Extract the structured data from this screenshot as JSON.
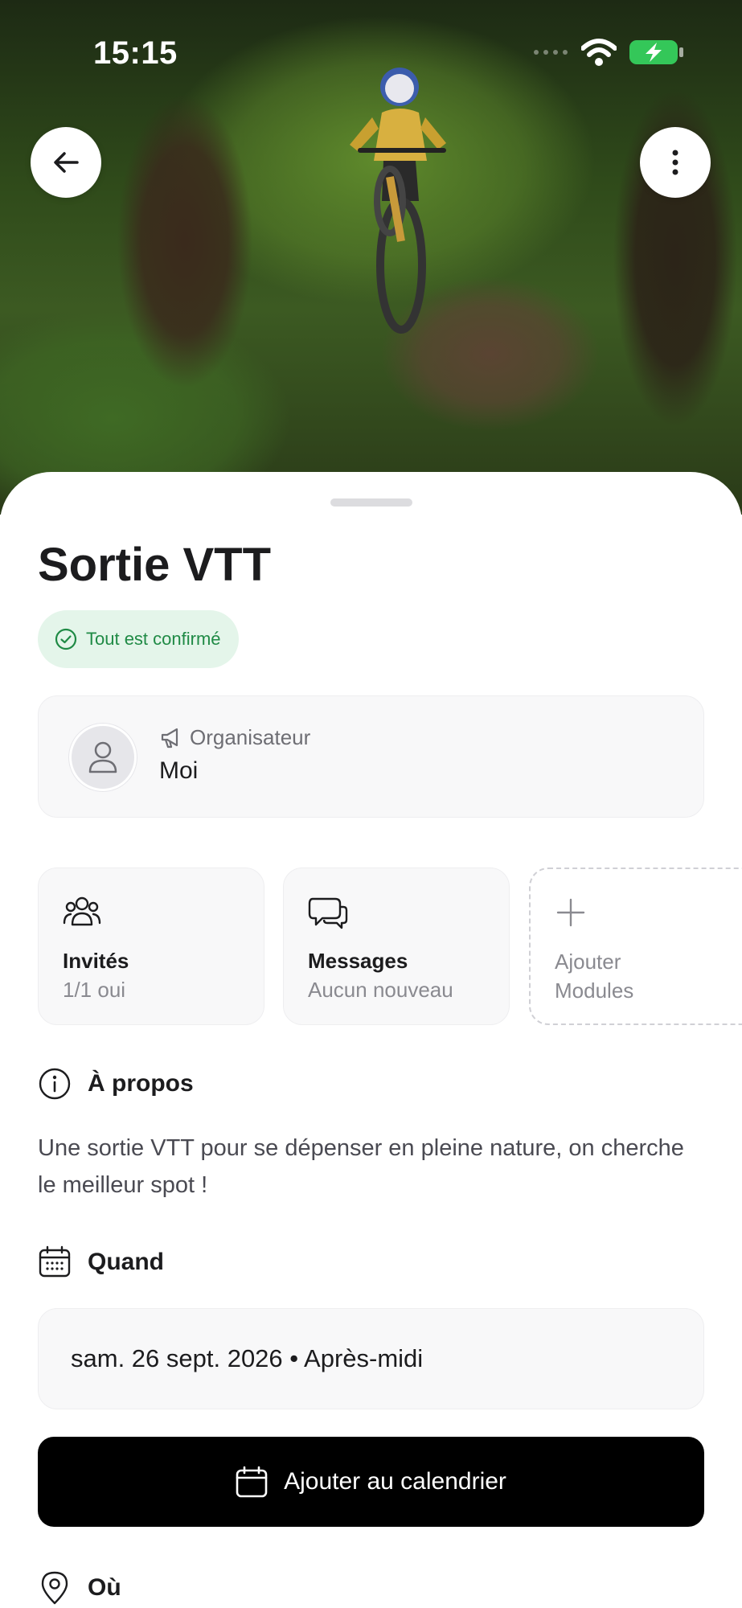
{
  "status_bar": {
    "time": "15:15"
  },
  "event": {
    "title": "Sortie VTT",
    "status": "Tout est confirmé"
  },
  "organizer": {
    "label": "Organisateur",
    "name": "Moi"
  },
  "modules": [
    {
      "title": "Invités",
      "subtitle": "1/1 oui"
    },
    {
      "title": "Messages",
      "subtitle": "Aucun nouveau"
    },
    {
      "title": "Ajouter",
      "subtitle": "Modules"
    }
  ],
  "about": {
    "heading": "À propos",
    "text": "Une sortie VTT pour se dépenser en pleine nature, on cherche le meilleur spot !"
  },
  "when": {
    "heading": "Quand",
    "value": "sam. 26 sept. 2026 • Après-midi",
    "calendar_button": "Ajouter au calendrier"
  },
  "where": {
    "heading": "Où"
  },
  "colors": {
    "confirmed_bg": "#e4f5ea",
    "confirmed_text": "#1f8a45",
    "battery": "#34c759",
    "primary_button": "#000000"
  },
  "icons": {
    "back": "arrow-left-icon",
    "more": "more-vertical-icon",
    "status": "check-circle-icon",
    "organizer": "megaphone-icon",
    "avatar": "user-icon",
    "guests": "users-icon",
    "messages": "chat-bubbles-icon",
    "add": "plus-icon",
    "about": "info-icon",
    "when": "calendar-icon",
    "where": "map-pin-icon"
  }
}
